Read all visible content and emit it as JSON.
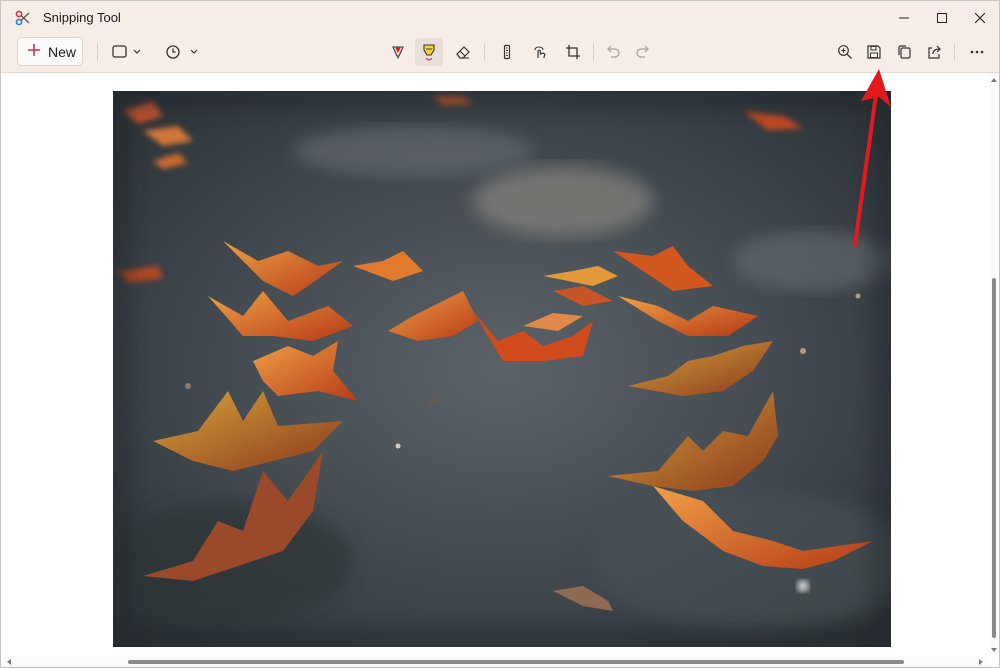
{
  "window": {
    "title": "Snipping Tool",
    "controls": {
      "minimize": "minimize-icon",
      "maximize": "maximize-icon",
      "close": "close-icon"
    }
  },
  "toolbar": {
    "new_label": "New",
    "tools": [
      {
        "name": "snip-mode",
        "icon": "rectangle-snip-icon"
      },
      {
        "name": "delay",
        "icon": "clock-icon"
      },
      {
        "name": "ballpoint-pen",
        "icon": "pen-icon"
      },
      {
        "name": "highlighter",
        "icon": "highlighter-icon",
        "active": true
      },
      {
        "name": "eraser",
        "icon": "eraser-icon"
      },
      {
        "name": "ruler",
        "icon": "ruler-icon"
      },
      {
        "name": "touch-writing",
        "icon": "touch-writing-icon"
      },
      {
        "name": "crop",
        "icon": "crop-icon"
      },
      {
        "name": "undo",
        "icon": "undo-icon"
      },
      {
        "name": "redo",
        "icon": "redo-icon"
      },
      {
        "name": "zoom",
        "icon": "zoom-icon"
      },
      {
        "name": "save",
        "icon": "save-icon"
      },
      {
        "name": "copy",
        "icon": "copy-icon"
      },
      {
        "name": "share",
        "icon": "share-icon"
      },
      {
        "name": "more",
        "icon": "more-icon"
      }
    ]
  },
  "canvas": {
    "image": "autumn-leaves-photo",
    "annotation": "red-arrow-pointing-to-save"
  },
  "colors": {
    "titlebar_bg": "#f5ede6",
    "accent_red": "#e11b1b",
    "new_plus": "#c4314b",
    "highlighter_yellow": "#f2d43b"
  }
}
